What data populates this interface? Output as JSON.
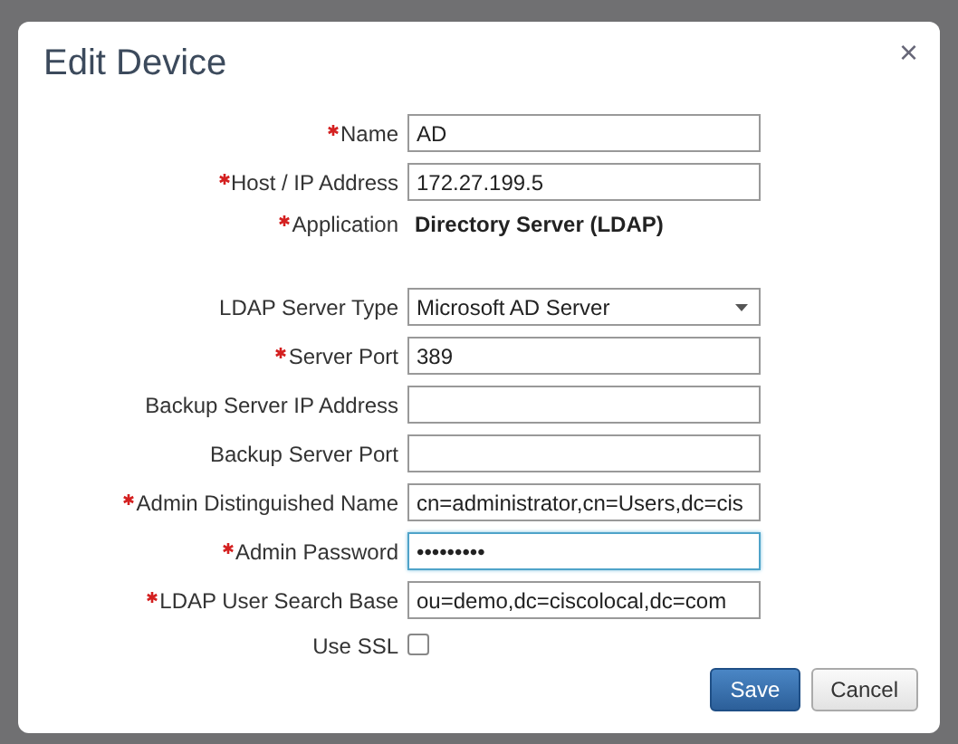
{
  "dialog": {
    "title": "Edit Device",
    "close": "×"
  },
  "fields": [
    {
      "kind": "text",
      "label": "Name",
      "required": true,
      "value": "AD",
      "focused": false
    },
    {
      "kind": "text",
      "label": "Host / IP Address",
      "required": true,
      "value": "172.27.199.5",
      "focused": false
    },
    {
      "kind": "static",
      "label": "Application",
      "required": true,
      "value": "Directory Server (LDAP)"
    },
    {
      "kind": "select",
      "label": "LDAP Server Type",
      "required": false,
      "value": "Microsoft AD Server"
    },
    {
      "kind": "text",
      "label": "Server Port",
      "required": true,
      "value": "389",
      "focused": false
    },
    {
      "kind": "text",
      "label": "Backup Server IP Address",
      "required": false,
      "focused": false
    },
    {
      "kind": "text",
      "label": "Backup Server Port",
      "required": false,
      "focused": false
    },
    {
      "kind": "text",
      "label": "Admin Distinguished Name",
      "required": true,
      "value": "cn=administrator,cn=Users,dc=cis",
      "focused": false
    },
    {
      "kind": "text",
      "label": "Admin Password",
      "required": true,
      "value": "•••••••••",
      "focused": true
    },
    {
      "kind": "text",
      "label": "LDAP User Search Base",
      "required": true,
      "value": "ou=demo,dc=ciscolocal,dc=com",
      "focused": false
    },
    {
      "kind": "checkbox",
      "label": "Use SSL",
      "required": false,
      "checked": false
    }
  ],
  "buttons": [
    {
      "label": "Save",
      "primary": true
    },
    {
      "label": "Cancel",
      "primary": false
    }
  ]
}
